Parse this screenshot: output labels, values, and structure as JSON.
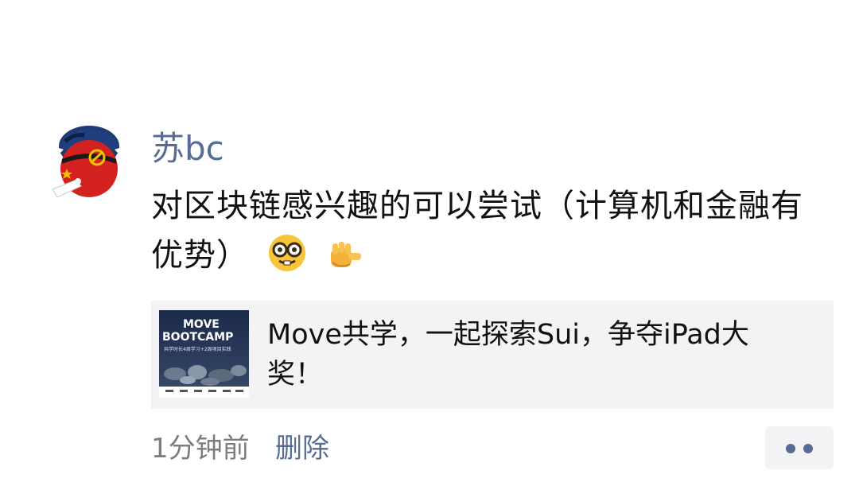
{
  "post": {
    "author": "苏bc",
    "text": "对区块链感兴趣的可以尝试（计算机和金融有优势）",
    "emojis": [
      "nerd-face-icon",
      "backhand-index-pointing-at-viewer-icon"
    ]
  },
  "link": {
    "title": "Move共学，一起探索Sui，争夺iPad大奖！",
    "thumbnail": {
      "headline_1": "MOVE",
      "headline_2": "BOOTCAMP",
      "subtitle": "共学时长4周学习+2周项目实践"
    }
  },
  "meta": {
    "time": "1分钟前",
    "delete_label": "删除"
  },
  "colors": {
    "link_blue": "#576b95",
    "card_bg": "#f3f3f5",
    "text": "#111111",
    "muted": "#7d7d7d"
  }
}
